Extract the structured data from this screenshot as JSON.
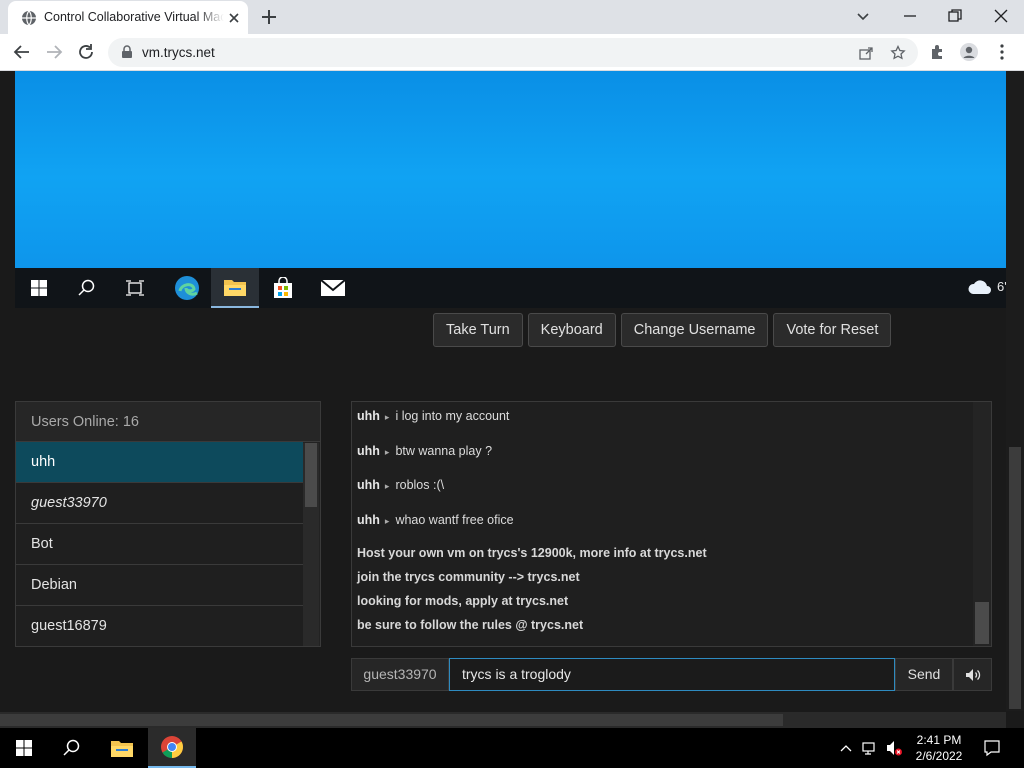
{
  "browser": {
    "tab_title": "Control Collaborative Virtual Machines",
    "url": "vm.trycs.net"
  },
  "vm": {
    "weather_text": "6'"
  },
  "vm_buttons": {
    "take_turn": "Take Turn",
    "keyboard": "Keyboard",
    "change_username": "Change Username",
    "vote_reset": "Vote for Reset"
  },
  "users": {
    "header": "Users Online: 16",
    "items": [
      {
        "name": "uhh"
      },
      {
        "name": "guest33970"
      },
      {
        "name": "Bot"
      },
      {
        "name": "Debian"
      },
      {
        "name": "guest16879"
      }
    ]
  },
  "chat": {
    "messages": [
      {
        "user": "uhh",
        "text": "i log into my account"
      },
      {
        "user": "uhh",
        "text": "btw wanna play ?"
      },
      {
        "user": "uhh",
        "text": "roblos :(\\"
      },
      {
        "user": "uhh",
        "text": "whao wantf free ofice"
      }
    ],
    "system": [
      "Host your own vm on trycs's 12900k, more info at trycs.net",
      "join the trycs community --> trycs.net",
      "looking for mods, apply at trycs.net",
      "be sure to follow the rules @ trycs.net"
    ],
    "username": "guest33970",
    "input_value": "trycs is a troglody",
    "send_label": "Send"
  },
  "taskbar": {
    "time": "2:41 PM",
    "date": "2/6/2022"
  }
}
